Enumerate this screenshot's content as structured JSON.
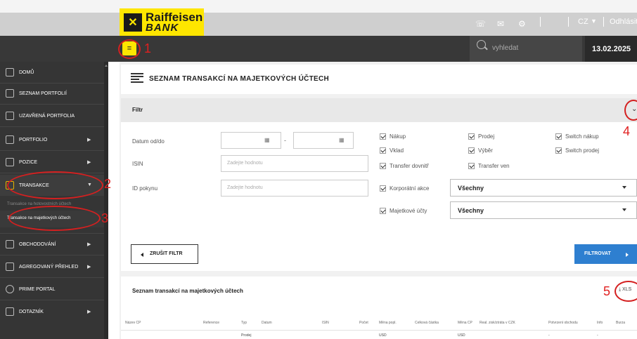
{
  "header": {
    "brand_line1": "Raiffeisen",
    "brand_line2": "BANK",
    "language": "CZ",
    "logout": "Odhlásit se",
    "icons": [
      "headset-icon",
      "mail-icon",
      "settings-icon"
    ]
  },
  "toolbar": {
    "search_placeholder": "vyhledat",
    "date": "13.02.2025"
  },
  "sidebar": {
    "items": [
      {
        "label": "DOMŮ",
        "icon": "home-icon"
      },
      {
        "label": "SEZNAM PORTFOLIÍ",
        "icon": "document-icon"
      },
      {
        "label": "UZAVŘENÁ PORTFOLIA",
        "icon": "closed-document-icon"
      },
      {
        "label": "PORTFOLIO",
        "icon": "folder-icon"
      },
      {
        "label": "POZICE",
        "icon": "positions-icon"
      },
      {
        "label": "TRANSAKCE",
        "icon": "transactions-icon"
      },
      {
        "label": "OBCHODOVÁNÍ",
        "icon": "trading-icon"
      },
      {
        "label": "AGREGOVANÝ PŘEHLED",
        "icon": "chart-icon"
      },
      {
        "label": "PRIME PORTAL",
        "icon": "globe-icon"
      },
      {
        "label": "DOTAZNÍK",
        "icon": "checklist-icon"
      }
    ],
    "sub_items": [
      "Transakce na hotovostních účtech",
      "Transakce na majetkových účtech"
    ]
  },
  "page": {
    "title": "SEZNAM TRANSAKCÍ NA MAJETKOVÝCH ÚČTECH"
  },
  "filter": {
    "title": "Filtr",
    "date_label": "Datum od/do",
    "isin_label": "ISIN",
    "isin_placeholder": "Zadejte hodnotu",
    "order_label": "ID pokynu",
    "order_placeholder": "Zadejte hodnotu",
    "checkboxes": [
      {
        "label": "Nákup",
        "checked": true
      },
      {
        "label": "Prodej",
        "checked": true
      },
      {
        "label": "Switch nákup",
        "checked": true
      },
      {
        "label": "Vklad",
        "checked": true
      },
      {
        "label": "Výběr",
        "checked": true
      },
      {
        "label": "Switch prodej",
        "checked": true
      },
      {
        "label": "Transfer dovnitř",
        "checked": true
      },
      {
        "label": "Transfer ven",
        "checked": true
      },
      {
        "label": "Korporátní akce",
        "checked": true
      },
      {
        "label": "Majetkové účty",
        "checked": true
      }
    ],
    "corporate_select": "Všechny",
    "accounts_select": "Všechny",
    "clear_button": "ZRUŠIT FILTR",
    "filter_button": "FILTROVAT"
  },
  "list": {
    "title": "Seznam transakcí na majetkových účtech",
    "export": "XLS",
    "columns": [
      "Název CP",
      "Reference",
      "Typ",
      "Datum",
      "ISIN",
      "Počet",
      "Měna popl.",
      "Celková částka",
      "Měna CP",
      "Real. zisk/ztráta v CZK",
      "Potvrzení obchodu",
      "Info",
      "Burza"
    ],
    "rows": [
      [
        "",
        "",
        "Prodej",
        "",
        "",
        "",
        "USD",
        "",
        "USD",
        "",
        "-",
        "-",
        ""
      ]
    ]
  },
  "annotations": {
    "color": "#e02020",
    "labels": [
      "1",
      "2",
      "3",
      "4",
      "5"
    ]
  },
  "colors": {
    "brand_yellow": "#fee600",
    "accent_blue": "#2e7fd0",
    "sidebar_dark": "#353535"
  }
}
